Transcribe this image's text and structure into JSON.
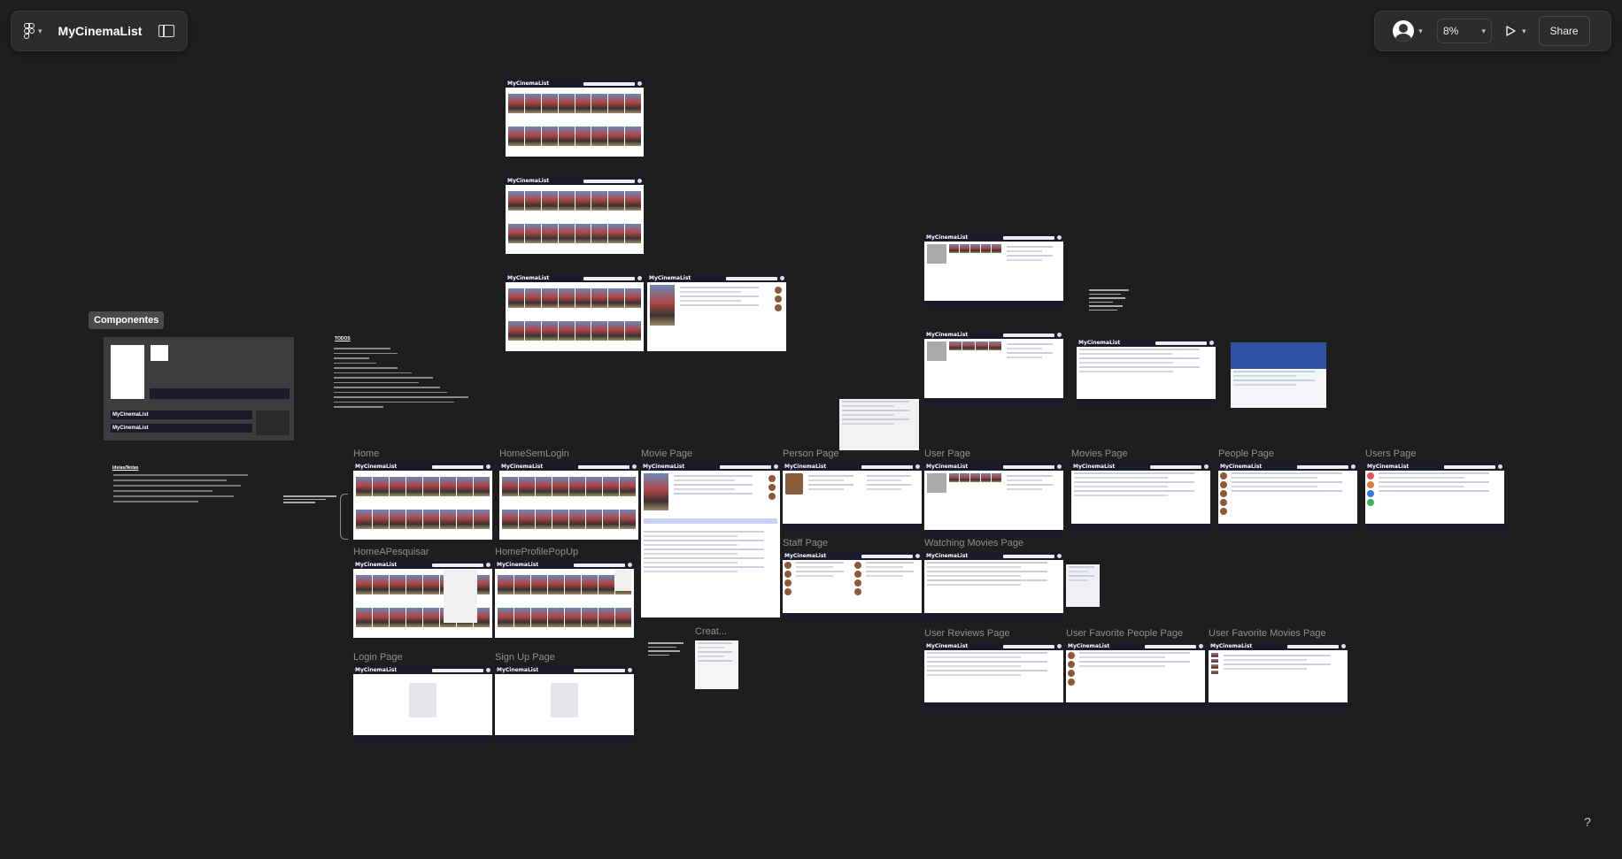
{
  "toolbar": {
    "file_title": "MyCinemaList",
    "zoom": "8%",
    "share_label": "Share",
    "help_label": "?"
  },
  "app_logo": "MyCinemaList",
  "components": {
    "title": "Componentes"
  },
  "notes": {
    "todos_title": "TODOS",
    "ideas_title": "Ideias/Notas"
  },
  "frames": [
    {
      "id": "home",
      "label": "Home",
      "type": "posters"
    },
    {
      "id": "home-sem-login",
      "label": "HomeSemLogin",
      "type": "posters"
    },
    {
      "id": "movie-page",
      "label": "Movie Page",
      "type": "movie"
    },
    {
      "id": "person-page",
      "label": "Person Page",
      "type": "person"
    },
    {
      "id": "user-page",
      "label": "User Page",
      "type": "user"
    },
    {
      "id": "movies-page",
      "label": "Movies Page",
      "type": "list"
    },
    {
      "id": "people-page",
      "label": "People Page",
      "type": "faces"
    },
    {
      "id": "users-page",
      "label": "Users Page",
      "type": "faces"
    },
    {
      "id": "home-a-pesquisar",
      "label": "HomeAPesquisar",
      "type": "posters"
    },
    {
      "id": "home-profile-popup",
      "label": "HomeProfilePopUp",
      "type": "posters"
    },
    {
      "id": "staff-page",
      "label": "Staff Page",
      "type": "faces"
    },
    {
      "id": "watching-movies-page",
      "label": "Watching Movies Page",
      "type": "list"
    },
    {
      "id": "login-page",
      "label": "Login Page",
      "type": "login"
    },
    {
      "id": "sign-up-page",
      "label": "Sign Up Page",
      "type": "login"
    },
    {
      "id": "create",
      "label": "Creat...",
      "type": "list"
    },
    {
      "id": "user-reviews-page",
      "label": "User Reviews Page",
      "type": "list"
    },
    {
      "id": "user-favorite-people-page",
      "label": "User Favorite People Page",
      "type": "faces"
    },
    {
      "id": "user-favorite-movies-page",
      "label": "User Favorite Movies Page",
      "type": "list"
    }
  ]
}
